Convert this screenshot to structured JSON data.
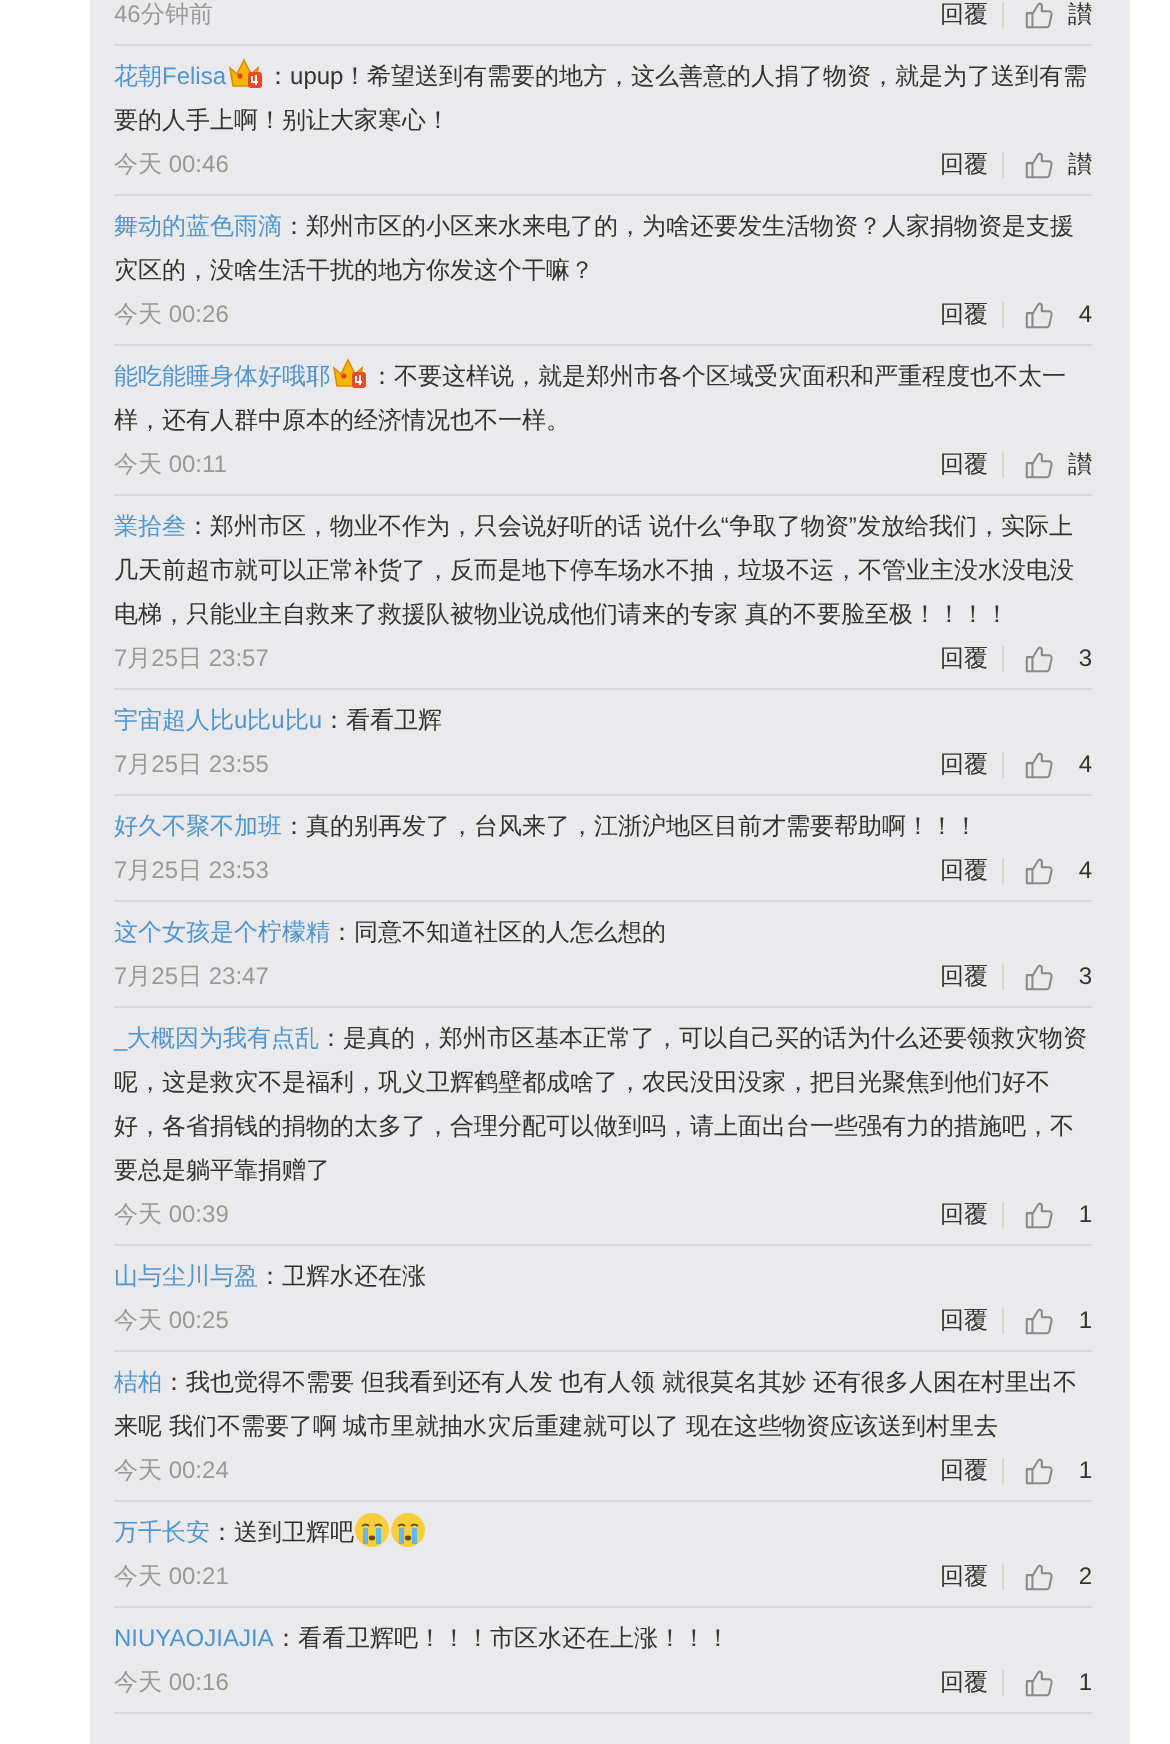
{
  "top_partial": {
    "time": "46分钟前",
    "reply": "回覆",
    "likes": "讃"
  },
  "comments": [
    {
      "user": "花朝Felisa",
      "vip": true,
      "text": "：upup！希望送到有需要的地方，这么善意的人捐了物资，就是为了送到有需要的人手上啊！别让大家寒心！",
      "time": "今天 00:46",
      "reply": "回覆",
      "likes": "讃"
    },
    {
      "user": "舞动的蓝色雨滴",
      "vip": false,
      "text": "：郑州市区的小区来水来电了的，为啥还要发生活物资？人家捐物资是支援灾区的，没啥生活干扰的地方你发这个干嘛？",
      "time": "今天 00:26",
      "reply": "回覆",
      "likes": "4"
    },
    {
      "user": "能吃能睡身体好哦耶",
      "vip": true,
      "text": "：不要这样说，就是郑州市各个区域受灾面积和严重程度也不太一样，还有人群中原本的经济情况也不一样。",
      "time": "今天 00:11",
      "reply": "回覆",
      "likes": "讃"
    },
    {
      "user": "業拾叁",
      "vip": false,
      "text": "：郑州市区，物业不作为，只会说好听的话 说什么“争取了物资”发放给我们，实际上几天前超市就可以正常补货了，反而是地下停车场水不抽，垃圾不运，不管业主没水没电没电梯，只能业主自救来了救援队被物业说成他们请来的专家 真的不要脸至极！！！！",
      "time": "7月25日 23:57",
      "reply": "回覆",
      "likes": "3"
    },
    {
      "user": "宇宙超人比u比u比u",
      "vip": false,
      "text": "：看看卫辉",
      "time": "7月25日 23:55",
      "reply": "回覆",
      "likes": "4"
    },
    {
      "user": "好久不聚不加班",
      "vip": false,
      "text": "：真的别再发了，台风来了，江浙沪地区目前才需要帮助啊！！！",
      "time": "7月25日 23:53",
      "reply": "回覆",
      "likes": "4"
    },
    {
      "user": "这个女孩是个柠檬精",
      "vip": false,
      "text": "：同意不知道社区的人怎么想的",
      "time": "7月25日 23:47",
      "reply": "回覆",
      "likes": "3"
    },
    {
      "user": "_大概因为我有点乱",
      "vip": false,
      "text": "：是真的，郑州市区基本正常了，可以自己买的话为什么还要领救灾物资呢，这是救灾不是福利，巩义卫辉鹤壁都成啥了，农民没田没家，把目光聚焦到他们好不好，各省捐钱的捐物的太多了，合理分配可以做到吗，请上面出台一些强有力的措施吧，不要总是躺平靠捐赠了",
      "time": "今天 00:39",
      "reply": "回覆",
      "likes": "1"
    },
    {
      "user": "山与尘川与盈",
      "vip": false,
      "text": "：卫辉水还在涨",
      "time": "今天 00:25",
      "reply": "回覆",
      "likes": "1"
    },
    {
      "user": "桔柏",
      "vip": false,
      "text": "：我也觉得不需要 但我看到还有人发 也有人领 就很莫名其妙 还有很多人困在村里出不来呢 我们不需要了啊 城市里就抽水灾后重建就可以了 现在这些物资应该送到村里去",
      "time": "今天 00:24",
      "reply": "回覆",
      "likes": "1"
    },
    {
      "user": "万千长安",
      "vip": false,
      "text": "：送到卫辉吧",
      "emojis": [
        {
          "kind": "crying"
        },
        {
          "kind": "crying"
        }
      ],
      "time": "今天 00:21",
      "reply": "回覆",
      "likes": "2"
    },
    {
      "user": "NIUYAOJIAJIA",
      "vip": false,
      "text": "：看看卫辉吧！！！市区水还在上涨！！！",
      "time": "今天 00:16",
      "reply": "回覆",
      "likes": "1"
    }
  ]
}
